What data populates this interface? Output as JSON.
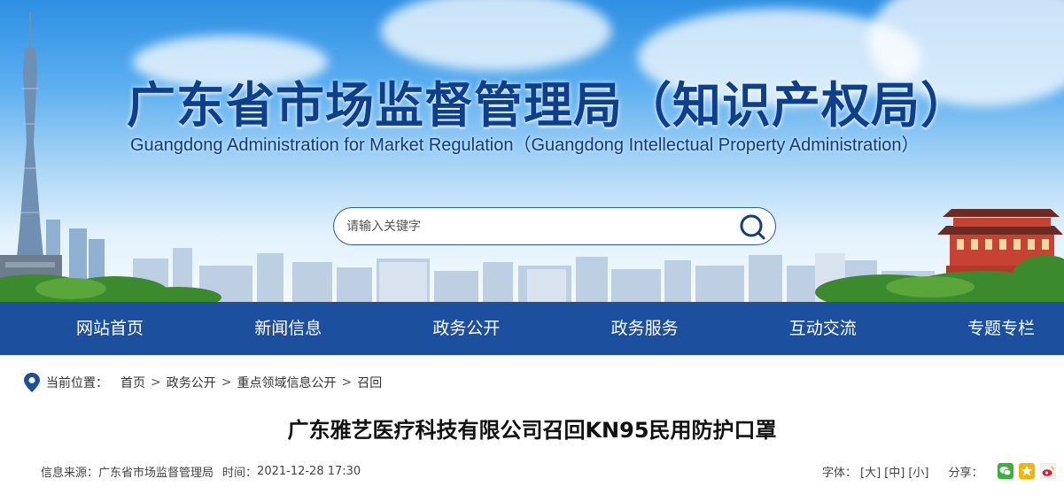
{
  "banner": {
    "title_cn": "广东省市场监督管理局（知识产权局）",
    "title_en": "Guangdong Administration for Market Regulation（Guangdong Intellectual Property Administration）"
  },
  "search": {
    "placeholder": "请输入关键字",
    "value": ""
  },
  "nav": {
    "items": [
      {
        "label": "网站首页"
      },
      {
        "label": "新闻信息"
      },
      {
        "label": "政务公开"
      },
      {
        "label": "政务服务"
      },
      {
        "label": "互动交流"
      },
      {
        "label": "专题专栏"
      }
    ]
  },
  "breadcrumb": {
    "label": "当前位置：",
    "items": [
      "首页",
      "政务公开",
      "重点领域信息公开",
      "召回"
    ],
    "separator": ">"
  },
  "article": {
    "title": "广东雅艺医疗科技有限公司召回KN95民用防护口罩",
    "source_label": "信息来源：",
    "source": "广东省市场监督管理局",
    "time_label": "时间：",
    "time": "2021-12-28 17:30"
  },
  "tools": {
    "font_label": "字体：",
    "sizes": [
      "[大]",
      "[中]",
      "[小]"
    ],
    "share_label": "分享：",
    "share_icons": [
      "wechat-icon",
      "qzone-icon",
      "weibo-icon"
    ]
  },
  "colors": {
    "nav_bg": "#1d4f9f",
    "title_blue": "#0e3f8c",
    "wechat": "#3bb13b",
    "qzone": "#f5b400",
    "weibo": "#e6162d"
  }
}
